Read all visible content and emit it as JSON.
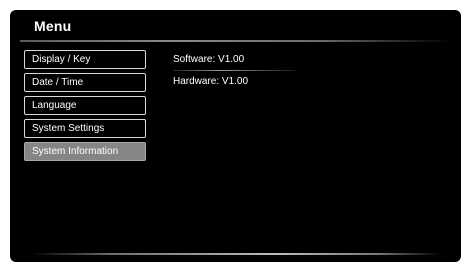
{
  "menu": {
    "title": "Menu",
    "items": [
      {
        "label": "Display / Key"
      },
      {
        "label": "Date / Time"
      },
      {
        "label": "Language"
      },
      {
        "label": "System Settings"
      },
      {
        "label": "System Information"
      }
    ],
    "selected_index": 4
  },
  "info": {
    "software": "Software: V1.00",
    "hardware": "Hardware: V1.00"
  },
  "colors": {
    "background": "#000000",
    "selected_item": "#858585",
    "text": "#ffffff"
  }
}
